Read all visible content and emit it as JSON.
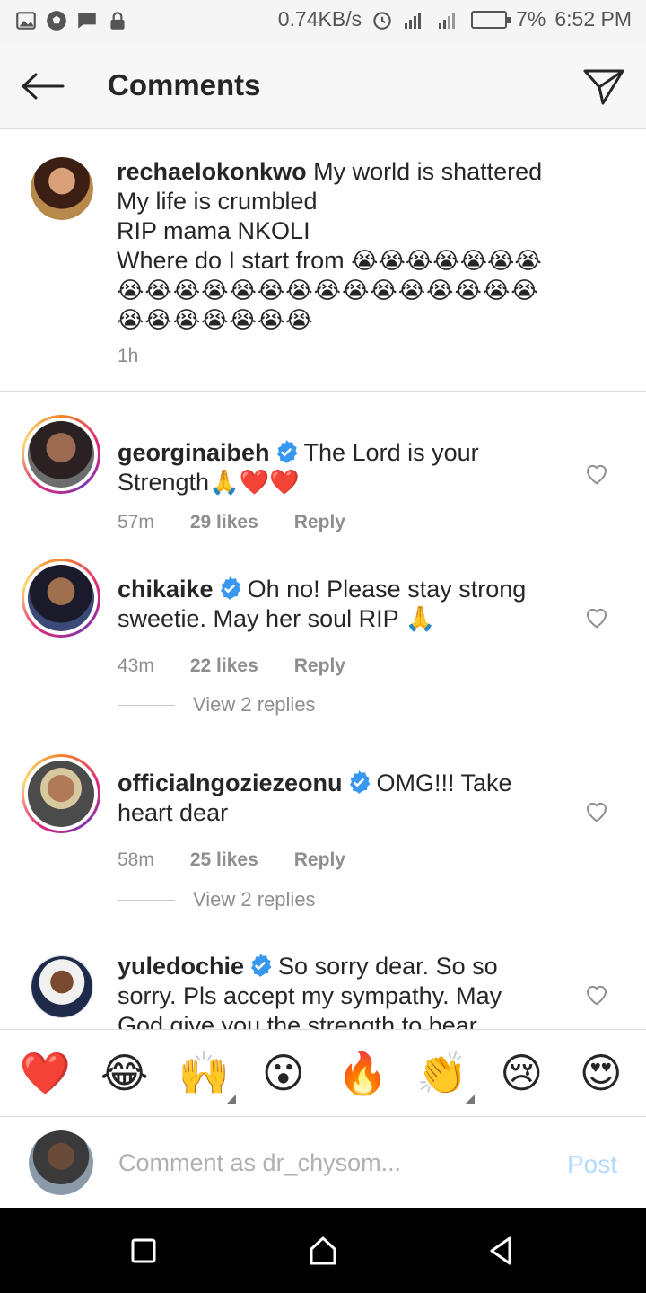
{
  "status_bar": {
    "speed": "0.74KB/s",
    "battery": "7%",
    "time": "6:52 PM"
  },
  "header": {
    "title": "Comments"
  },
  "caption": {
    "username": "rechaelokonkwo",
    "text": "My world is shattered\nMy  life is crumbled\nRIP mama NKOLI\nWhere do I start from ",
    "emoji_line1": "😭😭😭😭😭😭😭",
    "emoji_line2": "😭😭😭😭😭😭😭😭😭😭😭😭😭😭😭",
    "emoji_line3": "😭😭😭😭😭😭😭",
    "time": "1h"
  },
  "comments": [
    {
      "username": "georginaibeh",
      "text": "The Lord is your Strength🙏❤️❤️",
      "time": "57m",
      "likes": "29 likes",
      "reply": "Reply"
    },
    {
      "username": "chikaike",
      "text": "Oh no! Please stay strong sweetie. May her soul RIP 🙏",
      "time": "43m",
      "likes": "22 likes",
      "reply": "Reply",
      "view_replies": "View 2 replies"
    },
    {
      "username": "officialngoziezeonu",
      "text": "OMG!!! Take heart dear",
      "time": "58m",
      "likes": "25 likes",
      "reply": "Reply",
      "view_replies": "View 2 replies"
    },
    {
      "username": "yuledochie",
      "text": "So sorry dear. So so sorry. Pls accept my sympathy. May God give you the strength to bear"
    }
  ],
  "quick_emojis": [
    "❤️",
    "😂",
    "🙌",
    "😮",
    "🔥",
    "👏",
    "😢",
    "😍"
  ],
  "input": {
    "placeholder": "Comment as dr_chysom...",
    "post_label": "Post"
  },
  "colors": {
    "verified": "#3897f0",
    "post_disabled": "#b3dbff"
  }
}
